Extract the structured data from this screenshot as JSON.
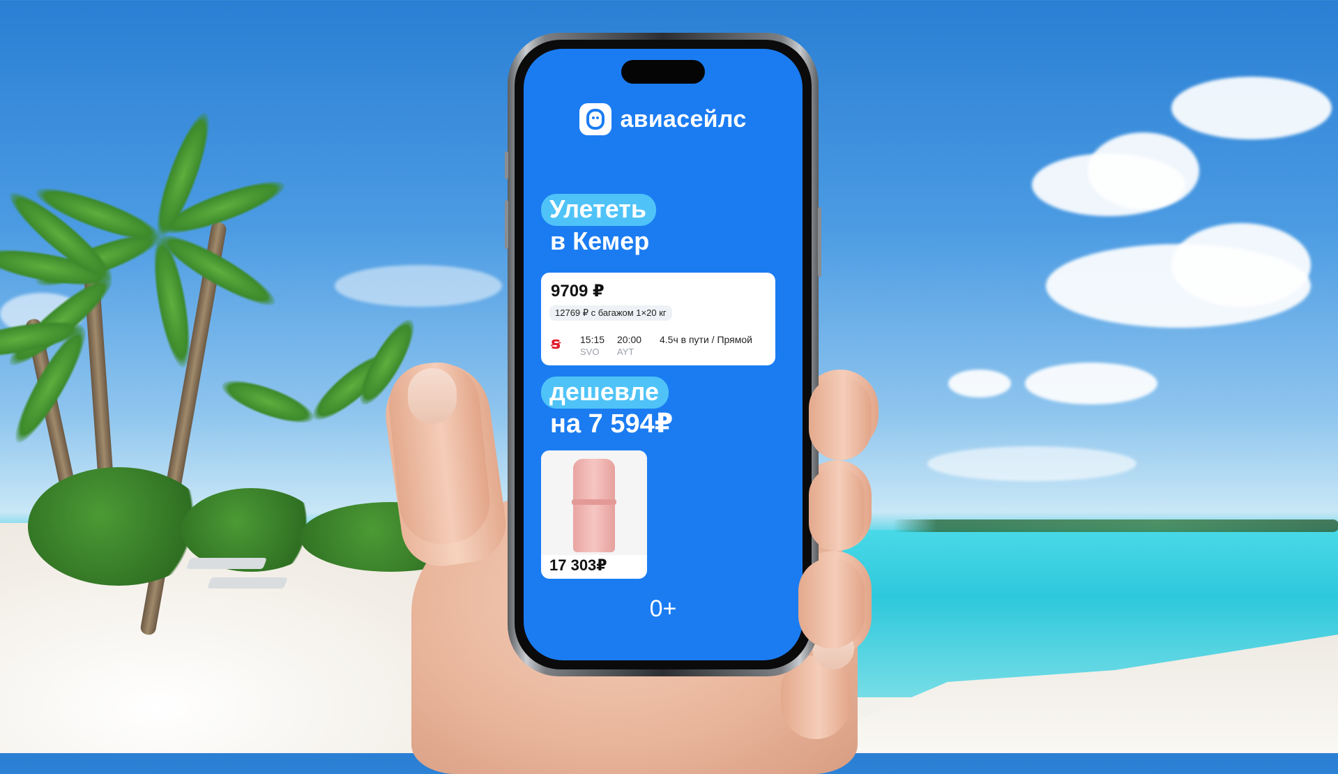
{
  "brand": {
    "name": "авиасейлс",
    "logo_icon": "aviasales-face-icon"
  },
  "headline": {
    "pill1": "Улететь",
    "line2": "в Кемер",
    "pill2": "дешевле",
    "line4": "на 7 594₽"
  },
  "flight_card": {
    "price": "9709 ₽",
    "baggage": "12769 ₽ с багажом 1×20 кг",
    "airline_icon": "s7-airline-icon",
    "depart_time": "15:15",
    "arrive_time": "20:00",
    "depart_code": "SVO",
    "arrive_code": "AYT",
    "duration": "4.5ч в пути / Прямой"
  },
  "product_card": {
    "price": "17 303₽",
    "image": "pink-coat"
  },
  "age_rating": "0+",
  "colors": {
    "screen": "#1b7cf2",
    "pill": "#4fc3f7",
    "accent_red": "#e11d2a"
  }
}
